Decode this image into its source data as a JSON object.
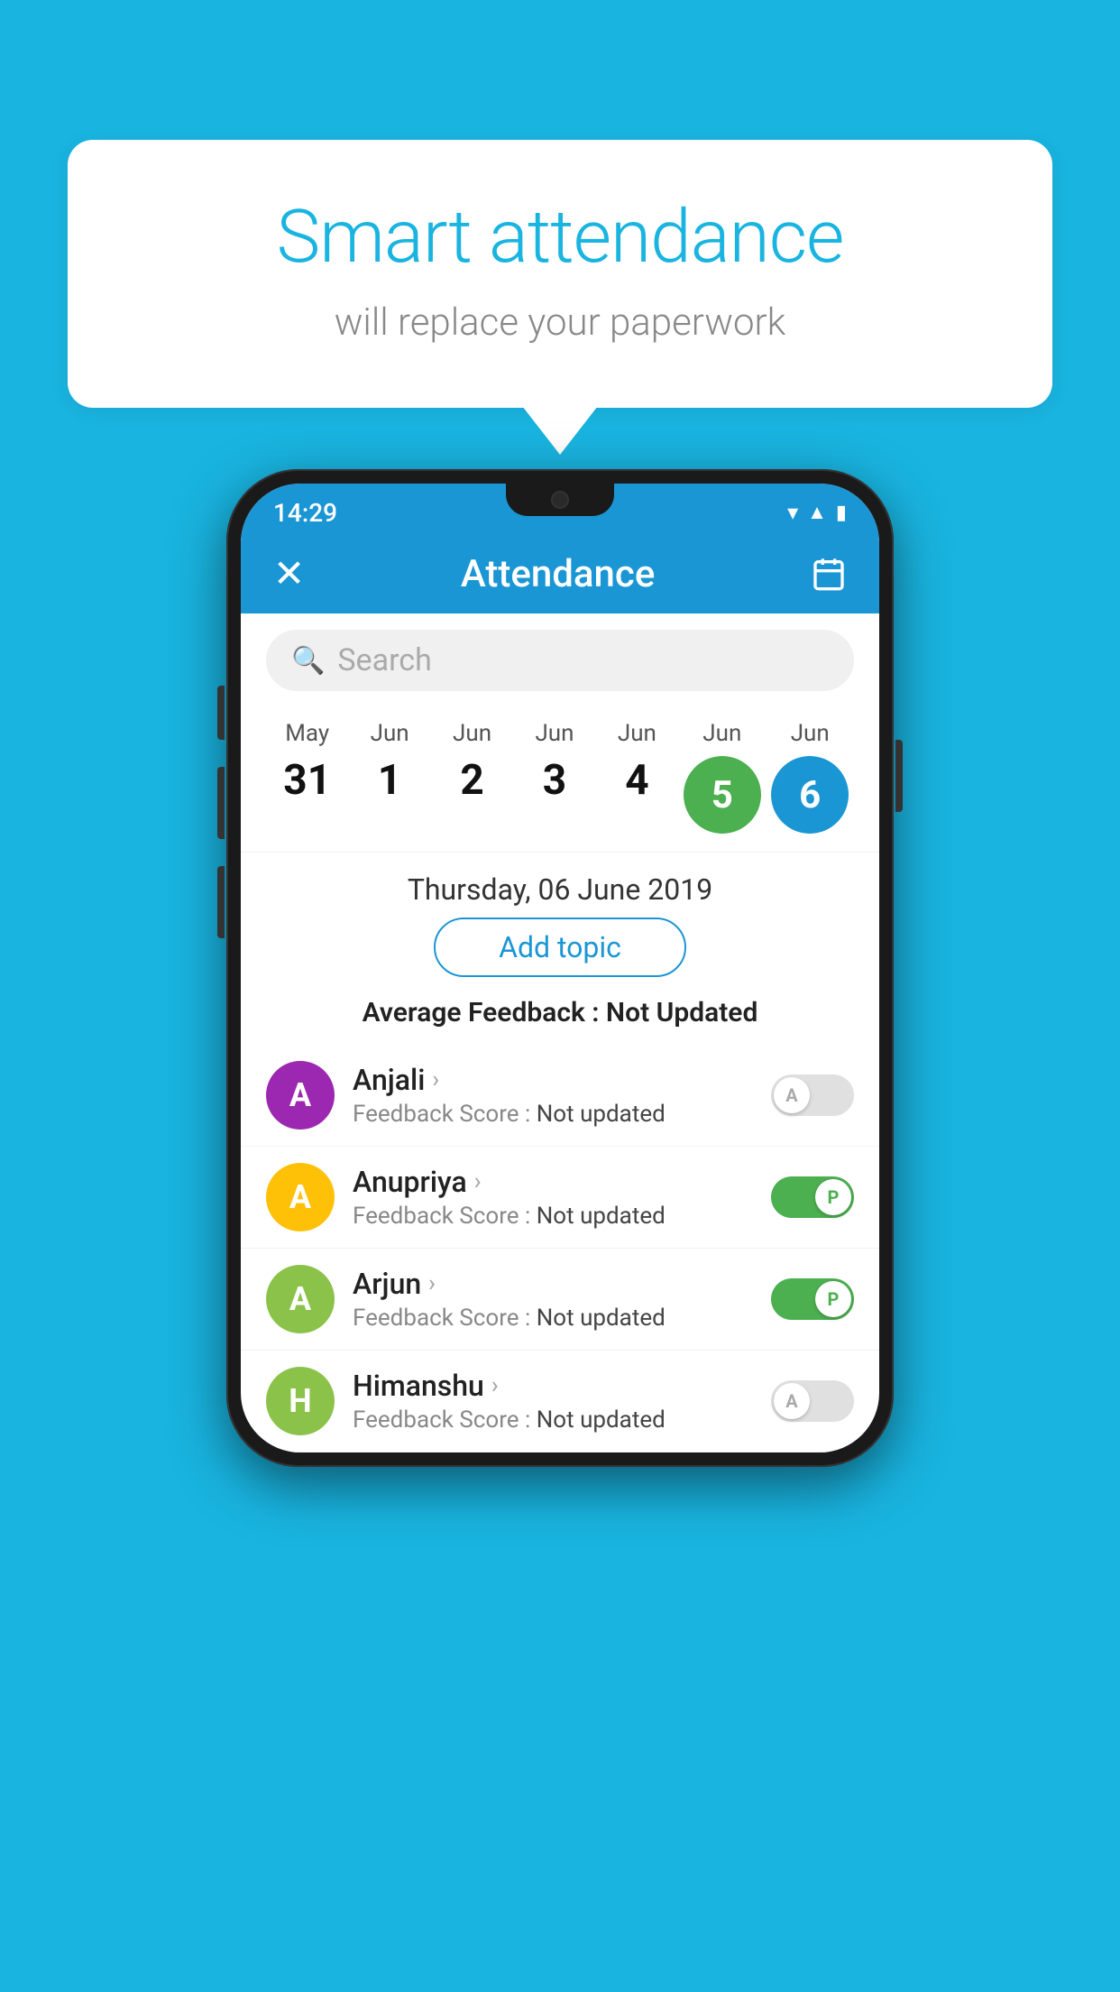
{
  "background": {
    "color": "#19b4e0"
  },
  "bubble": {
    "title": "Smart attendance",
    "subtitle": "will replace your paperwork"
  },
  "phone": {
    "status_bar": {
      "time": "14:29"
    },
    "app_bar": {
      "close_label": "✕",
      "title": "Attendance"
    },
    "search": {
      "placeholder": "Search"
    },
    "calendar": {
      "dates": [
        {
          "month": "May",
          "day": "31",
          "selected": false,
          "style": "plain"
        },
        {
          "month": "Jun",
          "day": "1",
          "selected": false,
          "style": "plain"
        },
        {
          "month": "Jun",
          "day": "2",
          "selected": false,
          "style": "plain"
        },
        {
          "month": "Jun",
          "day": "3",
          "selected": false,
          "style": "plain"
        },
        {
          "month": "Jun",
          "day": "4",
          "selected": false,
          "style": "plain"
        },
        {
          "month": "Jun",
          "day": "5",
          "selected": true,
          "style": "green"
        },
        {
          "month": "Jun",
          "day": "6",
          "selected": true,
          "style": "blue"
        }
      ],
      "selected_date_label": "Thursday, 06 June 2019"
    },
    "add_topic_button": "Add topic",
    "avg_feedback_label": "Average Feedback : ",
    "avg_feedback_value": "Not Updated",
    "students": [
      {
        "name": "Anjali",
        "avatar_letter": "A",
        "avatar_color": "purple",
        "feedback_label": "Feedback Score : ",
        "feedback_value": "Not updated",
        "toggle": "off",
        "toggle_label": "A"
      },
      {
        "name": "Anupriya",
        "avatar_letter": "A",
        "avatar_color": "yellow",
        "feedback_label": "Feedback Score : ",
        "feedback_value": "Not updated",
        "toggle": "on",
        "toggle_label": "P"
      },
      {
        "name": "Arjun",
        "avatar_letter": "A",
        "avatar_color": "green",
        "feedback_label": "Feedback Score : ",
        "feedback_value": "Not updated",
        "toggle": "on",
        "toggle_label": "P"
      },
      {
        "name": "Himanshu",
        "avatar_letter": "H",
        "avatar_color": "lime",
        "feedback_label": "Feedback Score : ",
        "feedback_value": "Not updated",
        "toggle": "off",
        "toggle_label": "A"
      }
    ]
  }
}
